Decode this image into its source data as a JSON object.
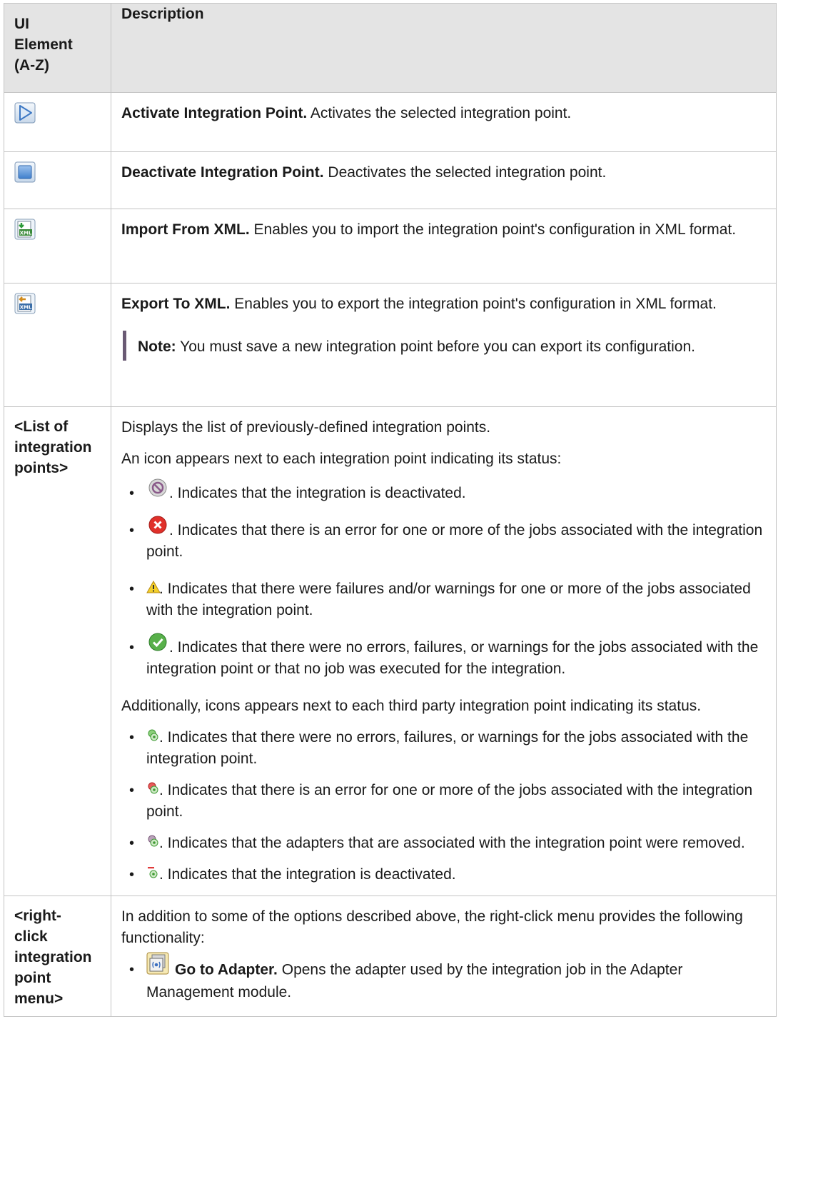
{
  "header": {
    "col1": "UI Element (A-Z)",
    "col1_lines": [
      "UI",
      "Element",
      "(A-Z)"
    ],
    "col2": "Description"
  },
  "rows": {
    "activate": {
      "icon": "play-triangle-icon",
      "title": "Activate Integration Point.",
      "text": " Activates the selected integration point."
    },
    "deactivate": {
      "icon": "stop-square-icon",
      "title": "Deactivate Integration Point.",
      "text": " Deactivates the selected integration point."
    },
    "import": {
      "icon": "import-xml-icon",
      "icon_text": "XML",
      "title": "Import From XML.",
      "text": " Enables you to import the integration point's configuration in XML format."
    },
    "export": {
      "icon": "export-xml-icon",
      "icon_text": "XML",
      "title": "Export To XML.",
      "text": " Enables you to export the integration point's configuration in XML format.",
      "note_label": "Note:",
      "note_text": " You must save a new integration point before you can export its configuration."
    },
    "list": {
      "key_lines": [
        "<List of",
        "integration",
        "points>"
      ],
      "p1": "Displays the list of previously-defined integration points.",
      "p2": "An icon appears next to each integration point indicating its status:",
      "status": [
        {
          "icon": "deactivated-status-icon",
          "text": ". Indicates that the integration is deactivated."
        },
        {
          "icon": "error-status-icon",
          "text": ". Indicates that there is an error for one or more of the jobs associated with the integration point."
        },
        {
          "icon": "warning-status-icon",
          "text": ". Indicates that there were failures and/or warnings for one or more of the jobs associated with the integration point."
        },
        {
          "icon": "success-status-icon",
          "text": ". Indicates that there were no errors, failures, or warnings for the jobs associated with the integration point or that no job was executed for the integration."
        }
      ],
      "p3": "Additionally, icons appears next to each third party integration point indicating its status.",
      "third_party": [
        {
          "icon": "third-party-ok-icon",
          "text": ". Indicates that there were no errors, failures, or warnings for the jobs associated with the integration point."
        },
        {
          "icon": "third-party-error-icon",
          "text": ". Indicates that there is an error for one or more of the jobs associated with the integration point."
        },
        {
          "icon": "third-party-removed-icon",
          "text": ". Indicates that the adapters that are associated with the integration point were removed."
        },
        {
          "icon": "third-party-deactivated-icon",
          "text": ". Indicates that the integration is deactivated."
        }
      ]
    },
    "rightclick": {
      "key_lines": [
        "<right-",
        "click",
        "integration",
        "point",
        "menu>"
      ],
      "p1": "In addition to some of the options described above, the right-click menu provides the following functionality:",
      "item_icon": "go-to-adapter-icon",
      "item_title": "Go to Adapter.",
      "item_text": " Opens the adapter used by the integration job in the Adapter Management module."
    }
  }
}
